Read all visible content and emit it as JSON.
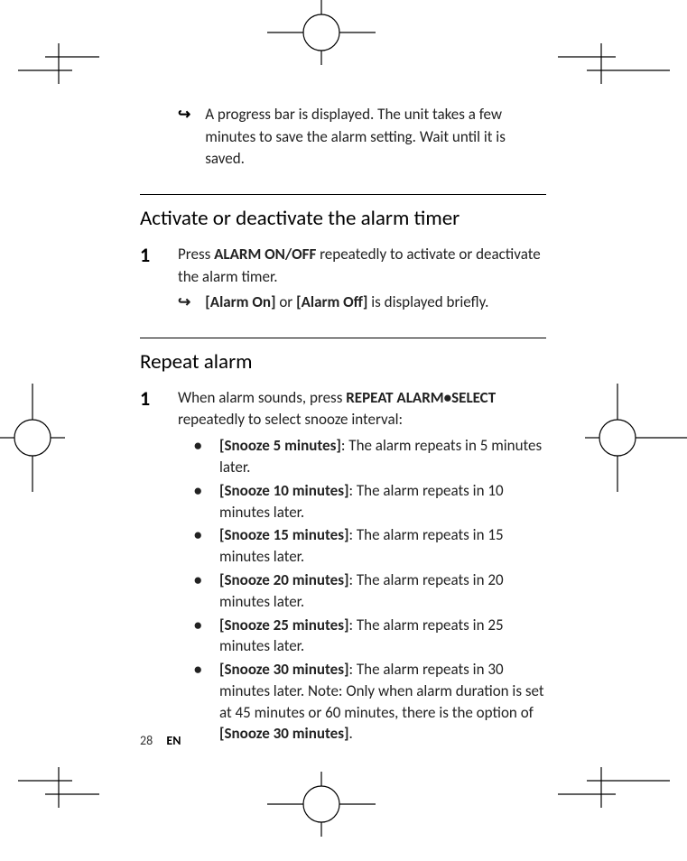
{
  "intro": {
    "result": "A progress bar is displayed. The unit takes a few minutes to save the alarm setting. Wait until it is saved."
  },
  "section1": {
    "heading": "Activate or deactivate the alarm timer",
    "step_num": "1",
    "step_pre": "Press ",
    "step_bold": "ALARM ON/OFF",
    "step_post": " repeatedly to activate or deactivate the alarm timer.",
    "result_b1": "[Alarm On]",
    "result_mid": " or ",
    "result_b2": "[Alarm Off]",
    "result_post": " is displayed briefly."
  },
  "section2": {
    "heading": "Repeat alarm",
    "step_num": "1",
    "step_pre": "When alarm sounds, press ",
    "step_bold": "REPEAT ALARM•SELECT",
    "step_post": " repeatedly to select snooze interval:",
    "bullets": [
      {
        "label": "[Snooze 5 minutes]",
        "desc": ": The alarm repeats in 5 minutes later."
      },
      {
        "label": "[Snooze 10 minutes]",
        "desc": ": The alarm repeats in 10 minutes later."
      },
      {
        "label": "[Snooze 15 minutes]",
        "desc": ": The alarm repeats in 15 minutes later."
      },
      {
        "label": "[Snooze 20 minutes]",
        "desc": ": The alarm repeats in 20 minutes later."
      },
      {
        "label": "[Snooze 25 minutes]",
        "desc": ": The alarm repeats in 25 minutes later."
      },
      {
        "label": "[Snooze 30 minutes]",
        "desc_pre": ": The alarm repeats in 30 minutes later. Note: Only when alarm duration is set at 45 minutes or 60 minutes, there is the option of ",
        "desc_bold": "[Snooze 30 minutes]",
        "desc_post": "."
      }
    ]
  },
  "footer": {
    "page": "28",
    "lang": "EN"
  }
}
